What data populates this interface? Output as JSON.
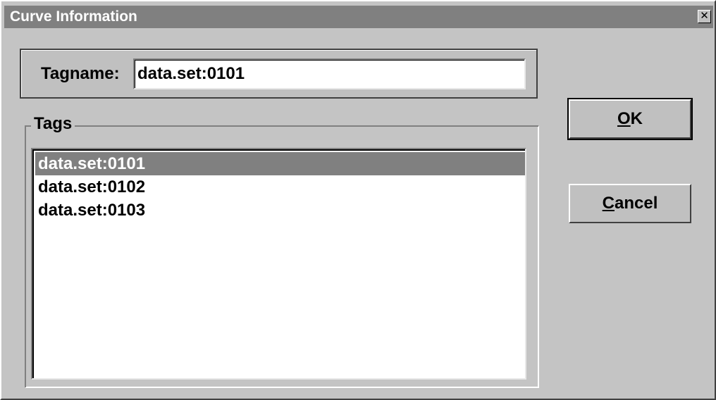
{
  "window": {
    "title": "Curve Information",
    "close_glyph": "✕",
    "colors": {
      "titlebar": "#808080",
      "face": "#c4c4c4",
      "selection": "#808080"
    }
  },
  "tagname": {
    "label": "Tagname:",
    "value": "data.set:0101"
  },
  "tags": {
    "legend": "Tags",
    "items": [
      {
        "label": "data.set:0101",
        "selected": true
      },
      {
        "label": "data.set:0102",
        "selected": false
      },
      {
        "label": "data.set:0103",
        "selected": false
      }
    ]
  },
  "buttons": {
    "ok": {
      "accel": "O",
      "rest": "K"
    },
    "cancel": {
      "accel": "C",
      "rest": "ancel"
    }
  }
}
